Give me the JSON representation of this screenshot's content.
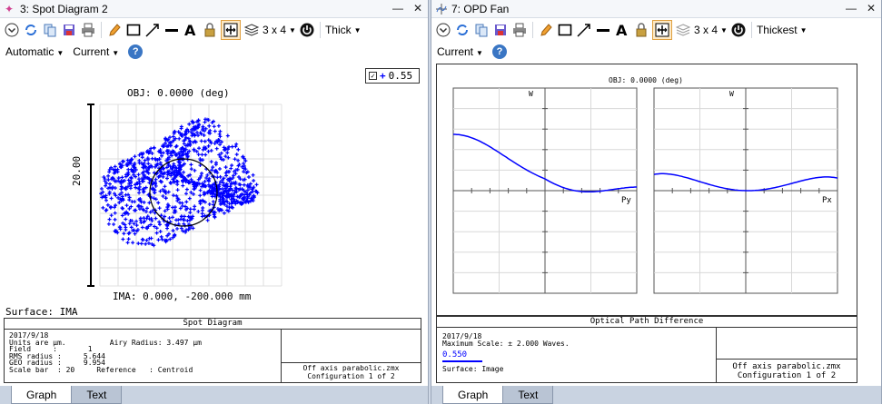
{
  "left": {
    "title": "3: Spot Diagram 2",
    "toolbar": {
      "layout": "3 x 4",
      "thickness": "Thick"
    },
    "toolbar2": {
      "mode": "Automatic",
      "config": "Current"
    },
    "legend_value": "0.55",
    "plot": {
      "obj_label": "OBJ: 0.0000 (deg)",
      "scale_label": "20.00",
      "ima_label": "IMA: 0.000, -200.000 mm",
      "surface": "Surface: IMA"
    },
    "footer": {
      "heading": "Spot Diagram",
      "lines": [
        "2017/9/18",
        "Units are µm.          Airy Radius: 3.497 µm",
        "Field     :       1",
        "RMS radius :     5.644",
        "GEO radius :     9.954",
        "Scale bar  : 20     Reference   : Centroid"
      ],
      "file": "Off axis parabolic.zmx",
      "config": "Configuration 1 of 2"
    },
    "tabs": [
      "Graph",
      "Text"
    ]
  },
  "right": {
    "title": "7: OPD Fan",
    "toolbar": {
      "layout": "3 x 4",
      "thickness": "Thickest"
    },
    "toolbar2": {
      "config": "Current"
    },
    "plot": {
      "obj_label": "OBJ: 0.0000 (deg)",
      "w_label": "W",
      "py_label": "Py",
      "px_label": "Px"
    },
    "footer": {
      "heading": "Optical Path Difference",
      "date": "2017/9/18",
      "max_scale": "Maximum Scale: ± 2.000 Waves.",
      "legend_value": "0.550",
      "surface": "Surface: Image",
      "file": "Off axis parabolic.zmx",
      "config": "Configuration 1 of 2"
    },
    "tabs": [
      "Graph",
      "Text"
    ]
  },
  "colors": {
    "series": "#0000ff",
    "accent": "#e0a040",
    "tab_bg": "#c9d3e1"
  }
}
